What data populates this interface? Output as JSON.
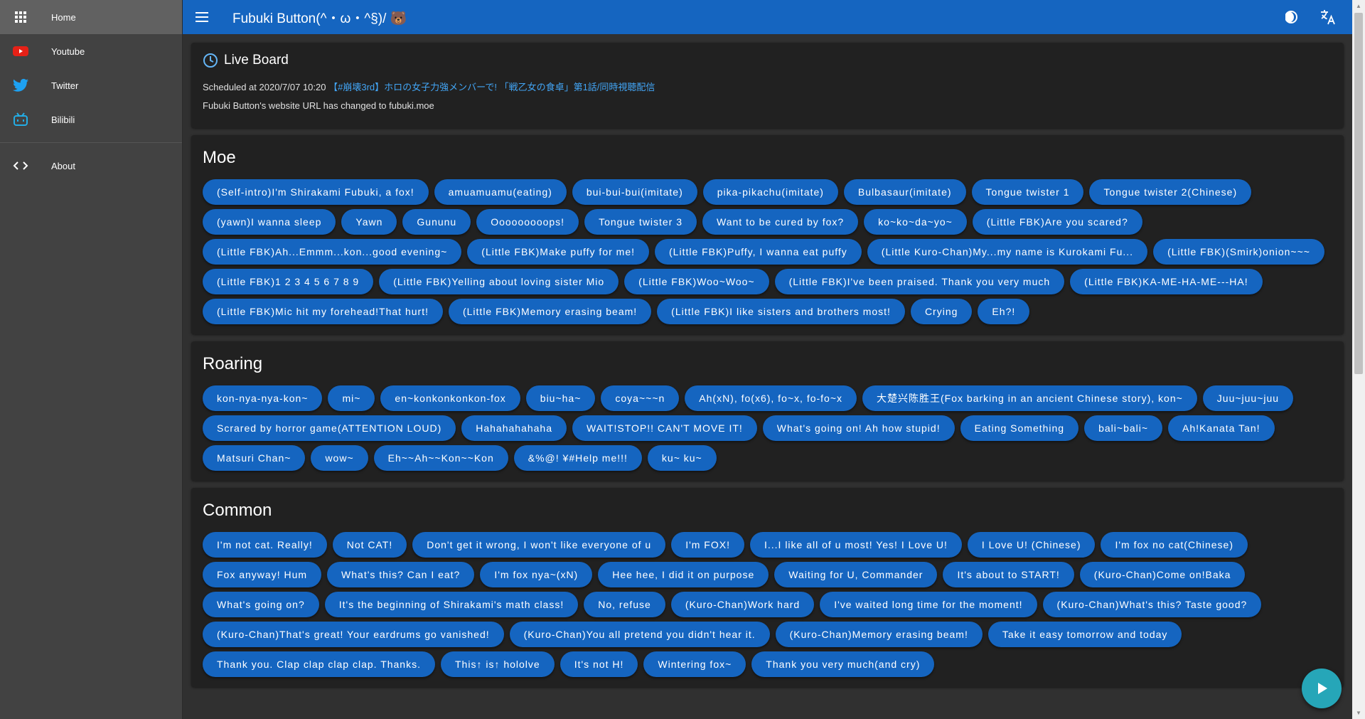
{
  "sidebar": {
    "items": [
      {
        "label": "Home",
        "icon": "apps-grid-icon"
      },
      {
        "label": "Youtube",
        "icon": "youtube-icon"
      },
      {
        "label": "Twitter",
        "icon": "twitter-icon"
      },
      {
        "label": "Bilibili",
        "icon": "bilibili-icon"
      }
    ],
    "about_label": "About"
  },
  "header": {
    "title": "Fubuki Button(^・ω・^§)/ 🐻",
    "accent_color": "#1565c0"
  },
  "live": {
    "title": "Live Board",
    "scheduled_prefix": "Scheduled at 2020/7/07 10:20",
    "stream_link": "【#崩壊3rd】ホロの女子力強メンバーで! 「戦乙女の食卓」第1話/同時視聴配信",
    "notice": "Fubuki Button's website URL has changed to fubuki.moe"
  },
  "sections": {
    "moe": {
      "title": "Moe",
      "buttons": [
        "(Self-intro)I'm Shirakami Fubuki, a fox!",
        "amuamuamu(eating)",
        "bui-bui-bui(imitate)",
        "pika-pikachu(imitate)",
        "Bulbasaur(imitate)",
        "Tongue twister 1",
        "Tongue twister 2(Chinese)",
        "(yawn)I wanna sleep",
        "Yawn",
        "Gununu",
        "Ooooooooops!",
        "Tongue twister 3",
        "Want to be cured by fox?",
        "ko~ko~da~yo~",
        "(Little FBK)Are you scared?",
        "(Little FBK)Ah...Emmm...kon...good evening~",
        "(Little FBK)Make puffy for me!",
        "(Little FBK)Puffy, I wanna eat puffy",
        "(Little Kuro-Chan)My...my name is Kurokami Fu...",
        "(Little FBK)(Smirk)onion~~~",
        "(Little FBK)1 2 3 4 5 6 7 8 9",
        "(Little FBK)Yelling about loving sister Mio",
        "(Little FBK)Woo~Woo~",
        "(Little FBK)I've been praised. Thank you very much",
        "(Little FBK)KA-ME-HA-ME---HA!",
        "(Little FBK)Mic hit my forehead!That hurt!",
        "(Little FBK)Memory erasing beam!",
        "(Little FBK)I like sisters and brothers most!",
        "Crying",
        "Eh?!"
      ]
    },
    "roaring": {
      "title": "Roaring",
      "buttons": [
        "kon-nya-nya-kon~",
        "mi~",
        "en~konkonkonkon-fox",
        "biu~ha~",
        "coya~~~n",
        "Ah(xN), fo(x6), fo~x, fo-fo~x",
        "大楚兴陈胜王(Fox barking in an ancient Chinese story), kon~",
        "Juu~juu~juu",
        "Scrared by horror game(ATTENTION LOUD)",
        "Hahahahahaha",
        "WAIT!STOP!! CAN'T MOVE IT!",
        "What's going on! Ah how stupid!",
        "Eating Something",
        "bali~bali~",
        "Ah!Kanata Tan!",
        "Matsuri Chan~",
        "wow~",
        "Eh~~Ah~~Kon~~Kon",
        "&%@! ¥#Help me!!!",
        "ku~ ku~"
      ]
    },
    "common": {
      "title": "Common",
      "buttons": [
        "I'm not cat. Really!",
        "Not CAT!",
        "Don't get it wrong, I won't like everyone of u",
        "I'm FOX!",
        "I...I like all of u most! Yes! I Love U!",
        "I Love U! (Chinese)",
        "I'm fox no cat(Chinese)",
        "Fox anyway! Hum",
        "What's this? Can I eat?",
        "I'm fox nya~(xN)",
        "Hee hee, I did it on purpose",
        "Waiting for U, Commander",
        "It's about to START!",
        "(Kuro-Chan)Come on!Baka",
        "What's going on?",
        "It's the beginning of Shirakami's math class!",
        "No, refuse",
        "(Kuro-Chan)Work hard",
        "I've waited long time for the moment!",
        "(Kuro-Chan)What's this? Taste good?",
        "(Kuro-Chan)That's great! Your eardrums go vanished!",
        "(Kuro-Chan)You all pretend you didn't hear it.",
        "(Kuro-Chan)Memory erasing beam!",
        "Take it easy tomorrow and today",
        "Thank you. Clap clap clap clap. Thanks.",
        "This↑ is↑ hololve",
        "It's not H!",
        "Wintering fox~",
        "Thank you very much(and cry)"
      ]
    }
  }
}
